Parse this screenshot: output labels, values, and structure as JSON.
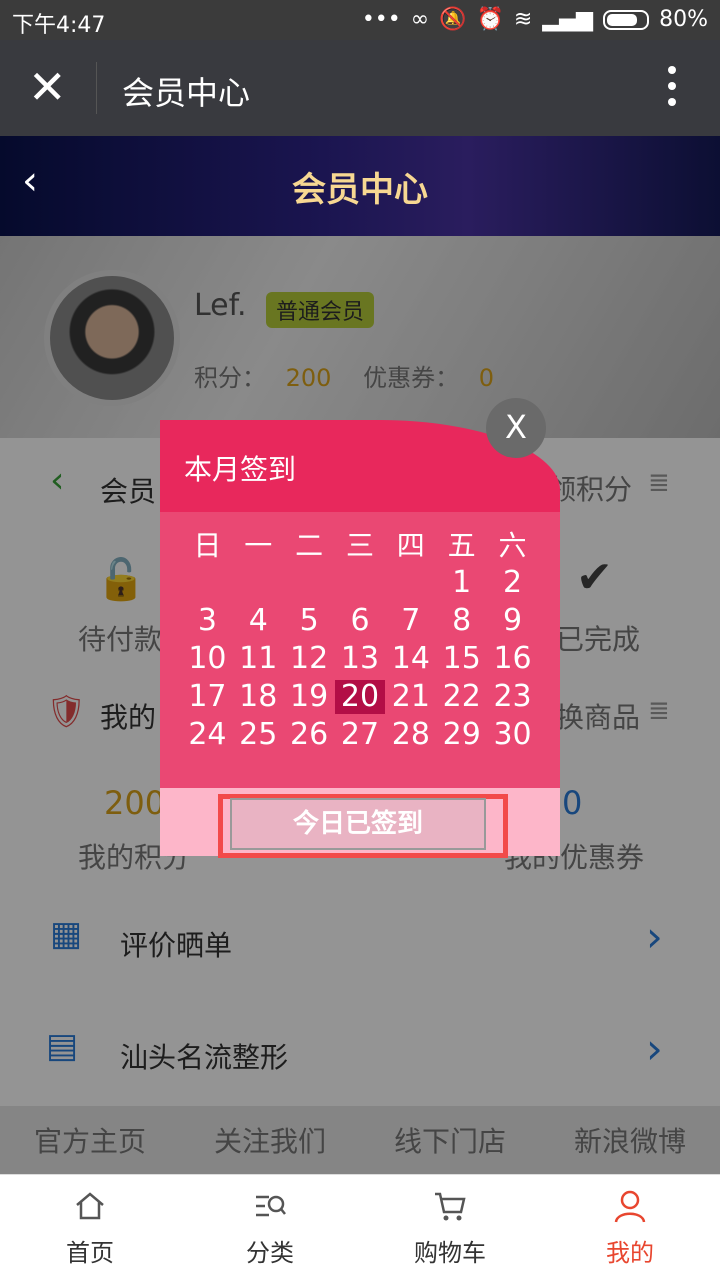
{
  "status_bar": {
    "time": "下午4:47",
    "battery": "80%",
    "icons": [
      "dots-icon",
      "sync-icon",
      "mute-icon",
      "alarm-icon",
      "wifi-icon",
      "signal-icon",
      "battery-icon"
    ]
  },
  "app_bar": {
    "title": "会员中心",
    "close_icon": "close-icon",
    "more_icon": "more-icon"
  },
  "page_header": {
    "title": "会员中心",
    "back_icon": "chevron-left-icon"
  },
  "profile": {
    "name": "Lef.",
    "level": "普通会员",
    "points_label": "积分：",
    "points": "200",
    "coupons_label": "优惠券：",
    "coupons": "0"
  },
  "rows": {
    "member_partial": "会员",
    "signin_partial": "到领积分",
    "pending_payment_partial": "待付款",
    "completed_partial": "已完成",
    "mine_partial": "我的",
    "redeem_partial": "换商品",
    "my_points_value_partial": "200",
    "my_points_label_partial": "我的积分",
    "coupon_value_partial": "0",
    "coupon_label_partial": "我的优惠券",
    "review": "评价晒单",
    "clinic": "汕头名流整形"
  },
  "footer_links": [
    "官方主页",
    "关注我们",
    "线下门店",
    "新浪微博"
  ],
  "tabs": [
    {
      "label": "首页",
      "icon": "home-icon",
      "active": false
    },
    {
      "label": "分类",
      "icon": "category-icon",
      "active": false
    },
    {
      "label": "购物车",
      "icon": "cart-icon",
      "active": false
    },
    {
      "label": "我的",
      "icon": "user-icon",
      "active": true
    }
  ],
  "dialog": {
    "title": "本月签到",
    "weekdays": [
      "日",
      "一",
      "二",
      "三",
      "四",
      "五",
      "六"
    ],
    "days": [
      "",
      "",
      "",
      "",
      "",
      "1",
      "2",
      "3",
      "4",
      "5",
      "6",
      "7",
      "8",
      "9",
      "10",
      "11",
      "12",
      "13",
      "14",
      "15",
      "16",
      "17",
      "18",
      "19",
      "20",
      "21",
      "22",
      "23",
      "24",
      "25",
      "26",
      "27",
      "28",
      "29",
      "30"
    ],
    "today": "20",
    "button": "今日已签到",
    "close": "X"
  },
  "colors": {
    "accent": "#e8285c",
    "today": "#b30e46",
    "active_tab": "#e8462f",
    "link_blue": "#2a7bd8"
  }
}
